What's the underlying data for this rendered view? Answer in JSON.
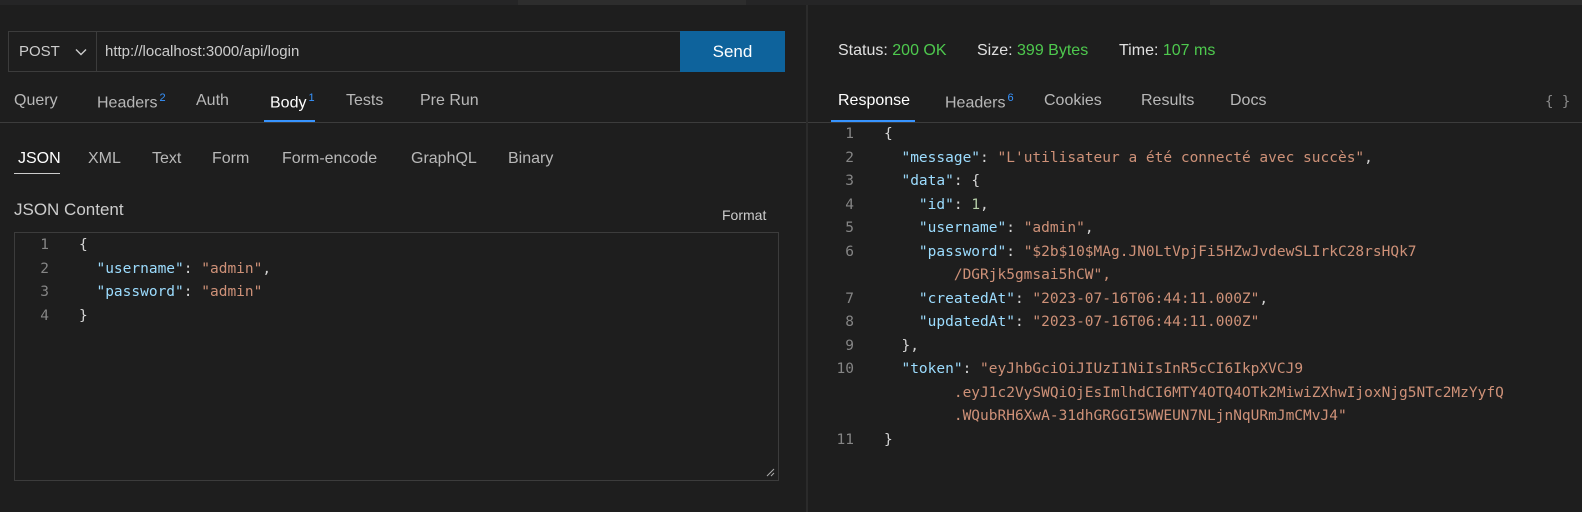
{
  "request": {
    "method": "POST",
    "url": "http://localhost:3000/api/login",
    "send_label": "Send"
  },
  "request_tabs": [
    {
      "label": "Query"
    },
    {
      "label": "Headers",
      "badge": "2"
    },
    {
      "label": "Auth"
    },
    {
      "label": "Body",
      "badge": "1"
    },
    {
      "label": "Tests"
    },
    {
      "label": "Pre Run"
    }
  ],
  "body_tabs": [
    "JSON",
    "XML",
    "Text",
    "Form",
    "Form-encode",
    "GraphQL",
    "Binary"
  ],
  "json_content_label": "JSON Content",
  "format_label": "Format",
  "request_body_lines": [
    {
      "n": "1",
      "text": "{"
    },
    {
      "n": "2",
      "text": "  \"username\": \"admin\","
    },
    {
      "n": "3",
      "text": "  \"password\": \"admin\""
    },
    {
      "n": "4",
      "text": "}"
    }
  ],
  "status": {
    "status_label": "Status:",
    "status_value": "200 OK",
    "size_label": "Size:",
    "size_value": "399 Bytes",
    "time_label": "Time:",
    "time_value": "107 ms"
  },
  "response_tabs": [
    {
      "label": "Response"
    },
    {
      "label": "Headers",
      "badge": "6"
    },
    {
      "label": "Cookies"
    },
    {
      "label": "Results"
    },
    {
      "label": "Docs"
    }
  ],
  "braces_label": "{ }",
  "response_lines": [
    {
      "n": "1",
      "text": "{"
    },
    {
      "n": "2",
      "text": "  \"message\": \"L'utilisateur a été connecté avec succès\","
    },
    {
      "n": "3",
      "text": "  \"data\": {"
    },
    {
      "n": "4",
      "text": "    \"id\": 1,"
    },
    {
      "n": "5",
      "text": "    \"username\": \"admin\","
    },
    {
      "n": "6",
      "text": "    \"password\": \"$2b$10$MAg.JN0LtVpjFi5HZwJvdewSLIrkC28rsHQk7"
    },
    {
      "n": "",
      "text": "        /DGRjk5gmsai5hCW\","
    },
    {
      "n": "7",
      "text": "    \"createdAt\": \"2023-07-16T06:44:11.000Z\","
    },
    {
      "n": "8",
      "text": "    \"updatedAt\": \"2023-07-16T06:44:11.000Z\""
    },
    {
      "n": "9",
      "text": "  },"
    },
    {
      "n": "10",
      "text": "  \"token\": \"eyJhbGciOiJIUzI1NiIsInR5cCI6IkpXVCJ9"
    },
    {
      "n": "",
      "text": "        .eyJ1c2VySWQiOjEsImlhdCI6MTY4OTQ4OTk2MiwiZXhwIjoxNjg5NTc2MzYyfQ"
    },
    {
      "n": "",
      "text": "        .WQubRH6XwA-31dhGRGGI5WWEUN7NLjnNqURmJmCMvJ4\""
    },
    {
      "n": "11",
      "text": "}"
    }
  ],
  "colors": {
    "background": "#1e1e1e",
    "accent": "#3794ff",
    "send_button": "#0e639c",
    "status_ok": "#4ec94e",
    "json_key": "#9cdcfe",
    "json_string": "#ce9178",
    "json_number": "#b5cea8"
  }
}
